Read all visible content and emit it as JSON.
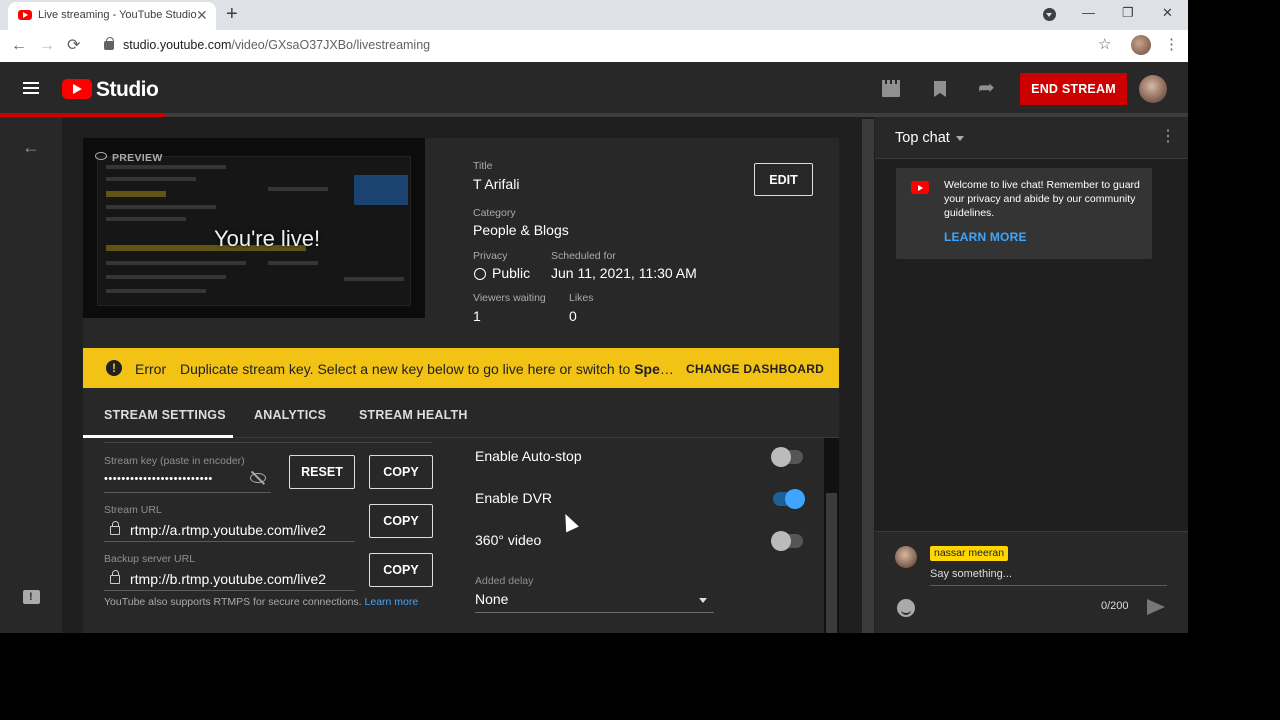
{
  "browser": {
    "tab_title": "Live streaming - YouTube Studio",
    "tab_close": "✕",
    "new_tab": "+",
    "url_host": "studio.youtube.com",
    "url_path": "/video/GXsaO37JXBo/livestreaming",
    "back": "←",
    "forward": "→",
    "reload": "⟳",
    "star": "☆",
    "menu": "⋮",
    "minimize": "—",
    "restore": "❐",
    "close": "✕"
  },
  "header": {
    "logo_word": "Studio",
    "end_stream_label": "END STREAM",
    "share_glyph": "➦",
    "stream_progress": 0.14
  },
  "nav": {
    "back_glyph": "←"
  },
  "preview": {
    "label": "PREVIEW",
    "live_text": "You're live!"
  },
  "stream_info": {
    "title_label": "Title",
    "title_value": "T Arifali",
    "category_label": "Category",
    "category_value": "People & Blogs",
    "privacy_label": "Privacy",
    "privacy_value": "Public",
    "scheduled_label": "Scheduled for",
    "scheduled_value": "Jun 11, 2021, 11:30 AM",
    "viewers_label": "Viewers waiting",
    "viewers_value": "1",
    "likes_label": "Likes",
    "likes_value": "0",
    "edit_label": "EDIT"
  },
  "error_bar": {
    "icon": "!",
    "title": "Error",
    "message_start": "Duplicate stream key. Select a new key below to go live here or switch to ",
    "message_bold": "Speec…",
    "action": "CHANGE DASHBOARD"
  },
  "tabs": [
    {
      "label": "STREAM SETTINGS"
    },
    {
      "label": "ANALYTICS"
    },
    {
      "label": "STREAM HEALTH"
    }
  ],
  "stream_settings": {
    "stream_key_label": "Stream key (paste in encoder)",
    "stream_key_value": "•••••••••••••••••••••••••",
    "reset_label": "RESET",
    "copy_label": "COPY",
    "stream_url_label": "Stream URL",
    "stream_url_value": "rtmp://a.rtmp.youtube.com/live2",
    "backup_url_label": "Backup server URL",
    "backup_url_value": "rtmp://b.rtmp.youtube.com/live2",
    "rtmps_note": "YouTube also supports RTMPS for secure connections.",
    "rtmps_link": "Learn more",
    "toggles": [
      {
        "label": "Enable Auto-stop",
        "on": false
      },
      {
        "label": "Enable DVR",
        "on": true
      },
      {
        "label": "360° video",
        "on": false
      }
    ],
    "delay_label": "Added delay",
    "delay_value": "None"
  },
  "chat": {
    "header": "Top chat",
    "menu_glyph": "⋮",
    "welcome_text": "Welcome to live chat! Remember to guard your privacy and abide by our community guidelines.",
    "learn_more": "LEARN MORE",
    "user_name": "nassar meeran",
    "input_placeholder": "Say something...",
    "char_count": "0/200"
  },
  "colors": {
    "accent_red": "#cc0000",
    "warning_yellow": "#f2c315",
    "link_blue": "#3ea6ff",
    "badge_yellow": "#ffd600"
  }
}
